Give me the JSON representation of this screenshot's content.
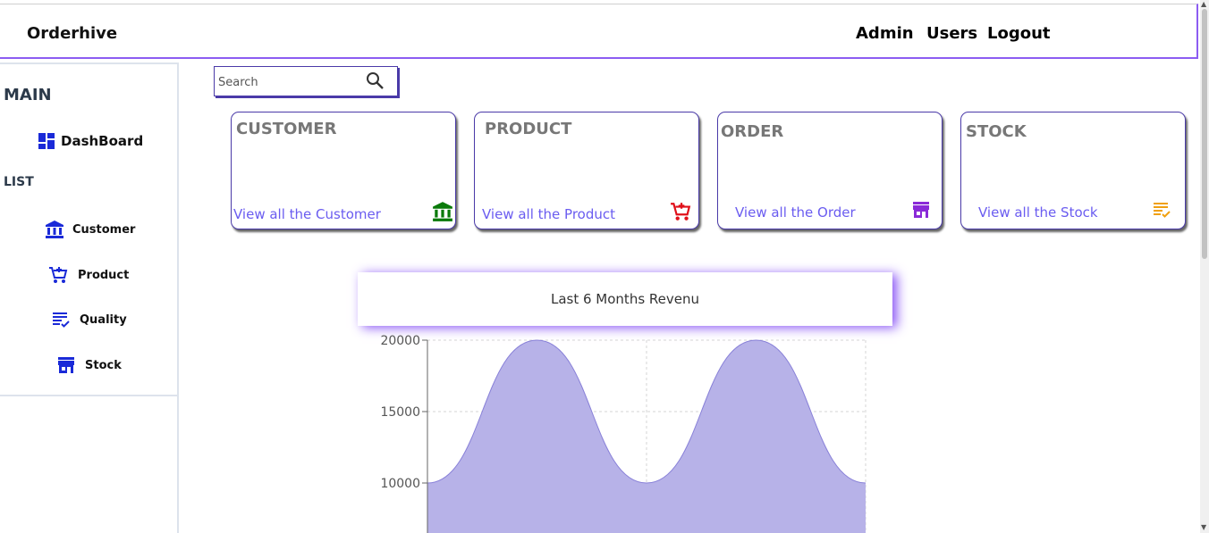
{
  "header": {
    "brand": "Orderhive",
    "nav": [
      "Admin",
      "Users",
      "Logout"
    ]
  },
  "sidebar": {
    "main_title": "MAIN",
    "dashboard_label": "DashBoard",
    "list_title": "LIST",
    "items": [
      {
        "label": "Customer",
        "icon": "bank-icon"
      },
      {
        "label": "Product",
        "icon": "cart-icon"
      },
      {
        "label": "Quality",
        "icon": "checklist-icon"
      },
      {
        "label": "Stock",
        "icon": "store-icon"
      }
    ]
  },
  "search": {
    "placeholder": "Search",
    "value": ""
  },
  "cards": [
    {
      "title": "CUSTOMER",
      "link": "View all the Customer",
      "icon": "bank-icon",
      "color": "#0a7a0a"
    },
    {
      "title": "PRODUCT",
      "link": "View all the Product",
      "icon": "cart-icon",
      "color": "#e0101a"
    },
    {
      "title": "ORDER",
      "link": "View all the Order",
      "icon": "store-icon",
      "color": "#8a2ad8"
    },
    {
      "title": "STOCK",
      "link": "View all the Stock",
      "icon": "checklist-icon",
      "color": "#f0a010"
    }
  ],
  "colors": {
    "accent": "#8c5cf2",
    "sidebar_icon": "#1a2ad8",
    "link": "#6a5cf0",
    "area_fill": "#b7b2e8",
    "area_stroke": "#8880d8"
  },
  "chart_data": {
    "type": "area",
    "title": "Last 6 Months Revenu",
    "x": [
      0,
      1,
      2,
      3,
      4
    ],
    "values": [
      10000,
      20000,
      10000,
      20000,
      10000
    ],
    "yticks": [
      10000,
      15000,
      20000
    ],
    "ylim": [
      10000,
      20000
    ],
    "grid": true,
    "xlabel": "",
    "ylabel": ""
  }
}
